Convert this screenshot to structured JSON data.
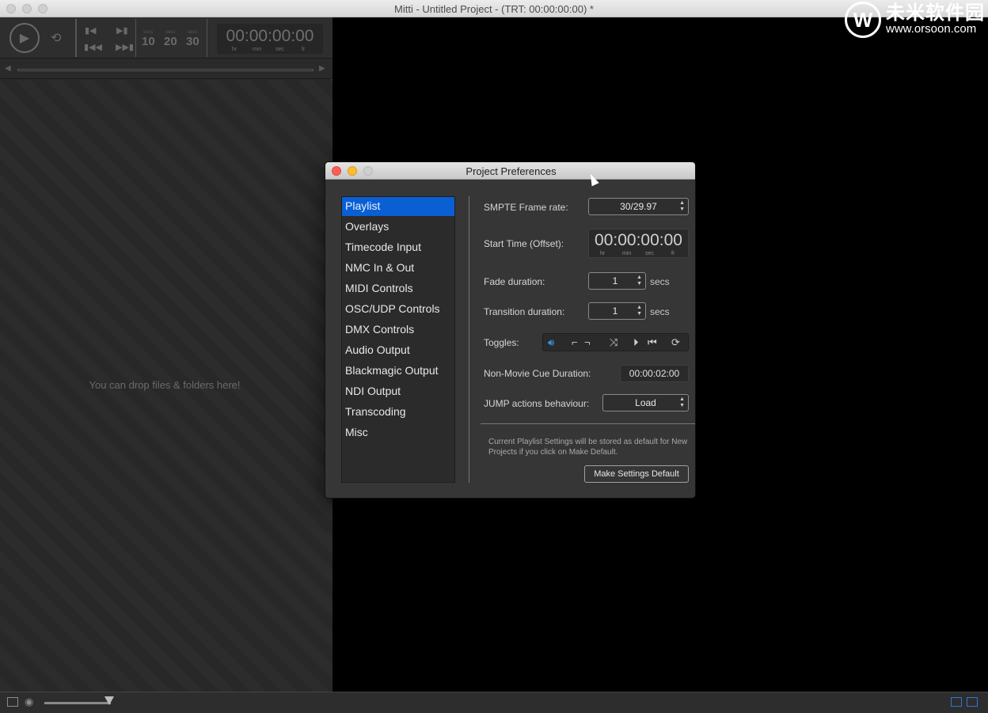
{
  "window": {
    "title": "Mitti - Untitled Project - (TRT: 00:00:00:00) *"
  },
  "watermark": {
    "logo": "W",
    "cn_text": "未米软件园",
    "url": "www.orsoon.com"
  },
  "transport": {
    "jump_values": [
      "10",
      "20",
      "30"
    ],
    "jump_sub": "secs",
    "timecode": "00:00:00:00",
    "timecode_labels": [
      "hr",
      "min",
      "sec",
      "fr"
    ]
  },
  "playlist": {
    "drop_hint": "You can drop files & folders here!"
  },
  "dialog": {
    "title": "Project Preferences",
    "nav_items": [
      "Playlist",
      "Overlays",
      "Timecode Input",
      "NMC In & Out",
      "MIDI Controls",
      "OSC/UDP Controls",
      "DMX Controls",
      "Audio Output",
      "Blackmagic Output",
      "NDI Output",
      "Transcoding",
      "Misc"
    ],
    "selected_nav": "Playlist",
    "smpte_label": "SMPTE Frame rate:",
    "smpte_value": "30/29.97",
    "start_time_label": "Start Time (Offset):",
    "start_time_value": "00:00:00:00",
    "start_time_units": [
      "hr",
      "min",
      "sec",
      "fr"
    ],
    "fade_label": "Fade duration:",
    "fade_value": "1",
    "fade_unit": "secs",
    "transition_label": "Transition duration:",
    "transition_value": "1",
    "transition_unit": "secs",
    "toggles_label": "Toggles:",
    "toggle_icons": [
      "speaker-icon",
      "fade-in-icon",
      "fade-out-icon",
      "shuffle-icon",
      "skip-next-icon",
      "skip-previous-icon",
      "loop-icon"
    ],
    "non_movie_label": "Non-Movie Cue Duration:",
    "non_movie_value": "00:00:02:00",
    "jump_label": "JUMP actions behaviour:",
    "jump_value": "Load",
    "note": "Current Playlist Settings will be stored as default for New Projects if you click on Make Default.",
    "make_default_label": "Make Settings Default"
  },
  "colors": {
    "selection": "#0a5fd3",
    "toggle_active": "#2f9be8",
    "layout_icon": "#2a79d8"
  }
}
